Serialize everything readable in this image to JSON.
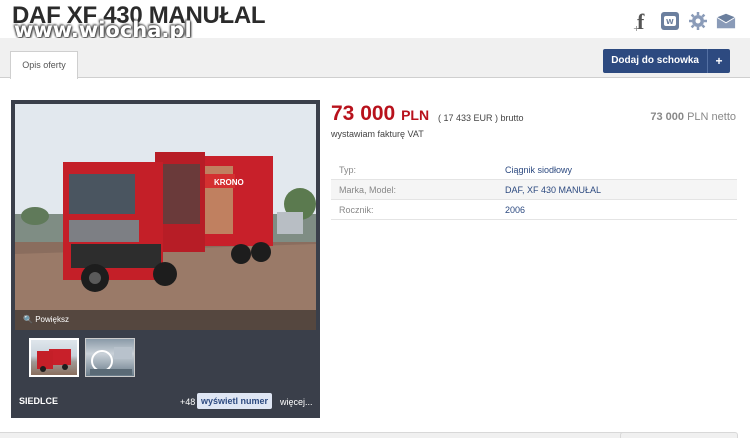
{
  "listing": {
    "title": "DAF XF 430 MANUŁAL",
    "watermark": "www.wiocha.pl"
  },
  "social": {
    "icons": [
      "facebook-icon",
      "wykop-icon",
      "settings-icon",
      "email-icon"
    ]
  },
  "tabs": {
    "description": "Opis oferty"
  },
  "actions": {
    "add_to_clipboard": "Dodaj do schowka",
    "plus": "+"
  },
  "price": {
    "amount": "73 000",
    "currency": "PLN",
    "eur": "( 17 433 EUR )",
    "gross": "brutto",
    "invoice": "wystawiam fakturę VAT",
    "net_amount": "73 000",
    "net_currency": "PLN netto"
  },
  "gallery": {
    "enlarge": "Powiększ",
    "location": "SIEDLCE",
    "photo_count": "+48",
    "show_number": "wyświetl numer",
    "more": "więcej..."
  },
  "params": [
    {
      "key": "Typ:",
      "value": "Ciągnik siodłowy"
    },
    {
      "key": "Marka, Model:",
      "value": "DAF, XF 430 MANUŁAL"
    },
    {
      "key": "Rocznik:",
      "value": "2006"
    }
  ],
  "colors": {
    "price": "#b8121c",
    "brand": "#2d4a80"
  }
}
